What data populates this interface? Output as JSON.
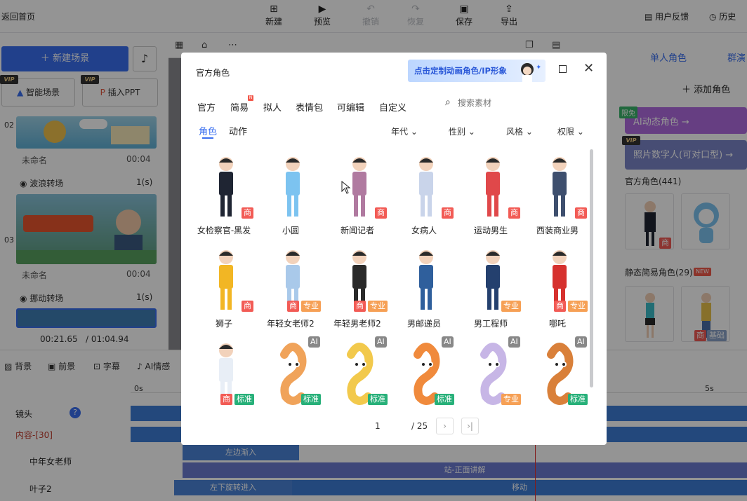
{
  "topbar": {
    "back": "返回首页",
    "buttons": [
      {
        "label": "新建",
        "icon": "plus-square-icon"
      },
      {
        "label": "预览",
        "icon": "play-icon"
      },
      {
        "label": "撤销",
        "icon": "undo-icon"
      },
      {
        "label": "恢复",
        "icon": "redo-icon"
      },
      {
        "label": "保存",
        "icon": "save-icon"
      },
      {
        "label": "导出",
        "icon": "export-icon"
      }
    ],
    "feedback": "用户反馈",
    "history": "历史"
  },
  "left_panel": {
    "new_scene": "新建场景",
    "smart_scene": "智能场景",
    "insert_ppt": "插入PPT",
    "vip": "VIP",
    "scenes": [
      {
        "num": "02",
        "name": "未命名",
        "duration": "00:04",
        "transition": "波浪转场",
        "transition_duration": "1(s)"
      },
      {
        "num": "03",
        "name": "未命名",
        "duration": "00:04",
        "transition": "挪动转场",
        "transition_duration": "1(s)"
      }
    ],
    "time_current": "00:21.65",
    "time_total": "/ 01:04.94"
  },
  "right_panel": {
    "tab_single": "单人角色",
    "tab_group": "群演",
    "add_role": "添加角色",
    "limit_tag": "限免",
    "ai_role": "AI动态角色 →",
    "photo_human": "照片数字人(可对口型) →",
    "official_count": "官方角色(441)",
    "static_count": "静态简易角色(29)",
    "new_badge": "NEW",
    "card_badges": [
      "商",
      "商",
      "基础"
    ]
  },
  "timeline": {
    "tools": [
      "背景",
      "前景",
      "字幕",
      "AI情感"
    ],
    "ruler_start": "0s",
    "ruler_5s": "5s",
    "rows": [
      {
        "label": "镜头"
      },
      {
        "label": "内容-[30]"
      },
      {
        "label": "中年女老师"
      },
      {
        "label": "叶子2"
      }
    ],
    "bars": {
      "left_in": "左边渐入",
      "stand_explain": "站-正面讲解",
      "rotate_in": "左下旋转进入",
      "move": "移动"
    }
  },
  "dialog": {
    "title": "官方角色",
    "promo": "点击定制动画角色/IP形象",
    "categories": [
      "官方",
      "简易",
      "拟人",
      "表情包",
      "可编辑",
      "自定义"
    ],
    "new_badge": "N",
    "search_placeholder": "搜索素材",
    "subtabs": [
      "角色",
      "动作"
    ],
    "filters": [
      "年代",
      "性别",
      "风格",
      "权限"
    ],
    "characters": [
      {
        "name": "女检察官-黑发",
        "badges": [
          "商"
        ],
        "color": "#1f2533"
      },
      {
        "name": "小圆",
        "badges": [],
        "color": "#7cc3f0"
      },
      {
        "name": "新闻记者",
        "badges": [
          "商"
        ],
        "color": "#b07aa0"
      },
      {
        "name": "女病人",
        "badges": [
          "商"
        ],
        "color": "#c9d4ea"
      },
      {
        "name": "运动男生",
        "badges": [
          "商"
        ],
        "color": "#e0484a"
      },
      {
        "name": "西装商业男",
        "badges": [
          "商"
        ],
        "color": "#3e4f6e"
      },
      {
        "name": "狮子",
        "badges": [
          "商"
        ],
        "color": "#f2b624"
      },
      {
        "name": "年轻女老师2",
        "badges": [
          "商",
          "专业"
        ],
        "color": "#a9c9ea"
      },
      {
        "name": "年轻男老师2",
        "badges": [
          "商",
          "专业"
        ],
        "color": "#2a2a2a"
      },
      {
        "name": "男邮递员",
        "badges": [],
        "color": "#2f5f9c"
      },
      {
        "name": "男工程师",
        "badges": [
          "专业"
        ],
        "color": "#24406e"
      },
      {
        "name": "哪吒",
        "badges": [
          "商",
          "专业"
        ],
        "color": "#d6312e"
      },
      {
        "name": "",
        "badges": [
          "商",
          "标准"
        ],
        "color": "#e8eef6"
      },
      {
        "name": "",
        "badges": [
          "AI",
          "标准"
        ],
        "color": "#f0a35a"
      },
      {
        "name": "",
        "badges": [
          "AI",
          "标准"
        ],
        "color": "#f2c94c"
      },
      {
        "name": "",
        "badges": [
          "AI",
          "标准"
        ],
        "color": "#f08a3c"
      },
      {
        "name": "",
        "badges": [
          "AI",
          "专业"
        ],
        "color": "#c7b6e6"
      },
      {
        "name": "",
        "badges": [
          "AI",
          "标准"
        ],
        "color": "#d9803a"
      }
    ],
    "page_current": "1",
    "page_total": "/ 25"
  }
}
